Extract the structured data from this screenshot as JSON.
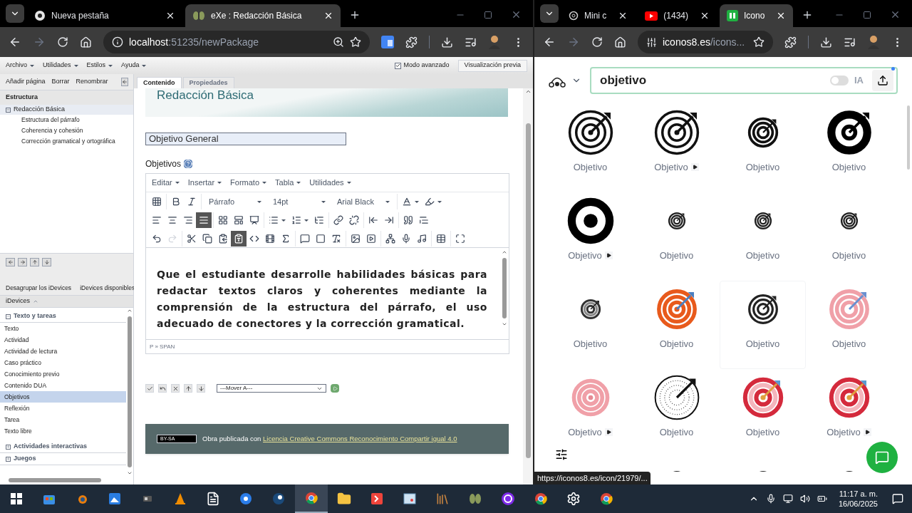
{
  "left_window": {
    "tabs": [
      {
        "title": "Nueva pestaña",
        "selected": false,
        "kind": "chrome"
      },
      {
        "title": "eXe : Redacción Básica",
        "selected": true,
        "kind": "exe"
      }
    ],
    "url": {
      "host": "localhost",
      "path": ":51235/newPackage"
    }
  },
  "exe": {
    "menu": [
      "Archivo",
      "Utilidades",
      "Estilos",
      "Ayuda"
    ],
    "advanced_mode": {
      "label": "Modo avanzado",
      "checked": true
    },
    "preview_button": "Visualización previa",
    "outline_actions": [
      "Añadir página",
      "Borrar",
      "Renombrar"
    ],
    "structure_title": "Estructura",
    "tree": {
      "label": "Redacción Básica",
      "expanded": true,
      "selected": true,
      "children": [
        {
          "label": "Estructura del párrafo"
        },
        {
          "label": "Coherencia y cohesión"
        },
        {
          "label": "Corrección gramatical y ortográfica"
        }
      ]
    },
    "idevice_tabs": [
      "Desagrupar los iDevices",
      "iDevices disponibles"
    ],
    "idevices_header": "iDevices",
    "idevice_groups": [
      {
        "label": "Texto y tareas",
        "expanded": true,
        "items": [
          {
            "label": "Texto",
            "selected": false
          },
          {
            "label": "Actividad",
            "selected": false
          },
          {
            "label": "Actividad de lectura",
            "selected": false
          },
          {
            "label": "Caso práctico",
            "selected": false
          },
          {
            "label": "Conocimiento previo",
            "selected": false
          },
          {
            "label": "Contenido DUA",
            "selected": false
          },
          {
            "label": "Objetivos",
            "selected": true
          },
          {
            "label": "Reflexión",
            "selected": false
          },
          {
            "label": "Tarea",
            "selected": false
          },
          {
            "label": "Texto libre",
            "selected": false
          }
        ]
      },
      {
        "label": "Actividades interactivas",
        "expanded": false
      },
      {
        "label": "Juegos",
        "expanded": false
      }
    ],
    "content_tabs": [
      {
        "label": "Contenido",
        "selected": true
      },
      {
        "label": "Propiedades",
        "selected": false
      }
    ],
    "banner_title": "Redacción Básica",
    "title_field": "Objetivo General",
    "section_label": "Objetivos",
    "editor": {
      "menus": [
        "Editar",
        "Insertar",
        "Formato",
        "Tabla",
        "Utilidades"
      ],
      "block_format": "Párrafo",
      "font_size": "14pt",
      "font_family": "Arial Black",
      "justify_pressed": true,
      "paste_text_pressed": true,
      "redo_disabled": true,
      "body": "Que el estudiante desarrolle habilidades básicas para redactar textos claros y coherentes mediante la comprensión de la estructura del párrafo, el uso adecuado de conectores y la corrección gramatical.",
      "path": "P » SPAN"
    },
    "move_select": "---Mover A---",
    "footer": {
      "badge": "BY-SA",
      "text": "Obra publicada con",
      "link": "Licencia Creative Commons Reconocimiento Compartir igual 4.0"
    }
  },
  "right_window": {
    "tabs": [
      {
        "title": "Mini c",
        "selected": false,
        "kind": "openai"
      },
      {
        "title": "(1434)",
        "selected": false,
        "kind": "youtube"
      },
      {
        "title": "Icono",
        "selected": true,
        "kind": "icons8"
      }
    ],
    "url": {
      "host": "iconos8.es",
      "path": "/icons..."
    },
    "search": {
      "value": "objetivo",
      "ai_label": "IA",
      "ai_on": false
    },
    "results": [
      {
        "label": "Objetivo",
        "kind": "ring-arrow",
        "animated": false,
        "hovered": false
      },
      {
        "label": "Objetivo",
        "kind": "ring-arrow",
        "animated": true,
        "hovered": false
      },
      {
        "label": "Objetivo",
        "kind": "ring-compact",
        "animated": false,
        "hovered": false
      },
      {
        "label": "Objetivo",
        "kind": "solid-arrow",
        "animated": false,
        "hovered": false
      },
      {
        "label": "Objetivo",
        "kind": "bullseye",
        "animated": true,
        "hovered": false
      },
      {
        "label": "Objetivo",
        "kind": "ring-small",
        "animated": false,
        "hovered": false
      },
      {
        "label": "Objetivo",
        "kind": "ring-small",
        "animated": false,
        "hovered": false
      },
      {
        "label": "Objetivo",
        "kind": "ring-small",
        "animated": false,
        "hovered": false
      },
      {
        "label": "Objetivo",
        "kind": "ring-small-gray",
        "animated": false,
        "hovered": false
      },
      {
        "label": "Objetivo",
        "kind": "orange-arrow",
        "animated": false,
        "hovered": false
      },
      {
        "label": "Objetivo",
        "kind": "ring-medium",
        "animated": false,
        "hovered": true
      },
      {
        "label": "Objetivo",
        "kind": "pink-arrow",
        "animated": false,
        "hovered": false
      },
      {
        "label": "Objetivo",
        "kind": "pink",
        "animated": true,
        "hovered": false
      },
      {
        "label": "Objetivo",
        "kind": "dotted-arrow",
        "animated": false,
        "hovered": false
      },
      {
        "label": "Objetivo",
        "kind": "red-arrow",
        "animated": false,
        "hovered": false
      },
      {
        "label": "Objetivo",
        "kind": "red-arrow",
        "animated": true,
        "hovered": false
      }
    ],
    "partial_row": [
      {
        "kind": "ring-small"
      },
      {
        "kind": "ring-small"
      },
      {
        "kind": "ring-small"
      }
    ],
    "status_url": "https://iconos8.es/icon/21979/..."
  },
  "taskbar": {
    "apps": [
      {
        "kind": "store",
        "active": false
      },
      {
        "kind": "blender",
        "active": false
      },
      {
        "kind": "photos",
        "active": false
      },
      {
        "kind": "gadget",
        "active": false
      },
      {
        "kind": "vlc",
        "active": false
      },
      {
        "kind": "file",
        "active": false
      },
      {
        "kind": "azure",
        "active": false
      },
      {
        "kind": "steam",
        "active": false
      },
      {
        "kind": "chrome",
        "active": true
      },
      {
        "kind": "folder",
        "active": false
      },
      {
        "kind": "anydesk",
        "active": false
      },
      {
        "kind": "panel",
        "active": false
      },
      {
        "kind": "books",
        "active": false
      },
      {
        "kind": "exe",
        "active": false
      },
      {
        "kind": "canva",
        "active": false
      },
      {
        "kind": "chrome",
        "active": false
      },
      {
        "kind": "settings",
        "active": false
      },
      {
        "kind": "chrome",
        "active": false
      }
    ],
    "time": "11:17 a. m.",
    "date": "16/06/2025"
  }
}
